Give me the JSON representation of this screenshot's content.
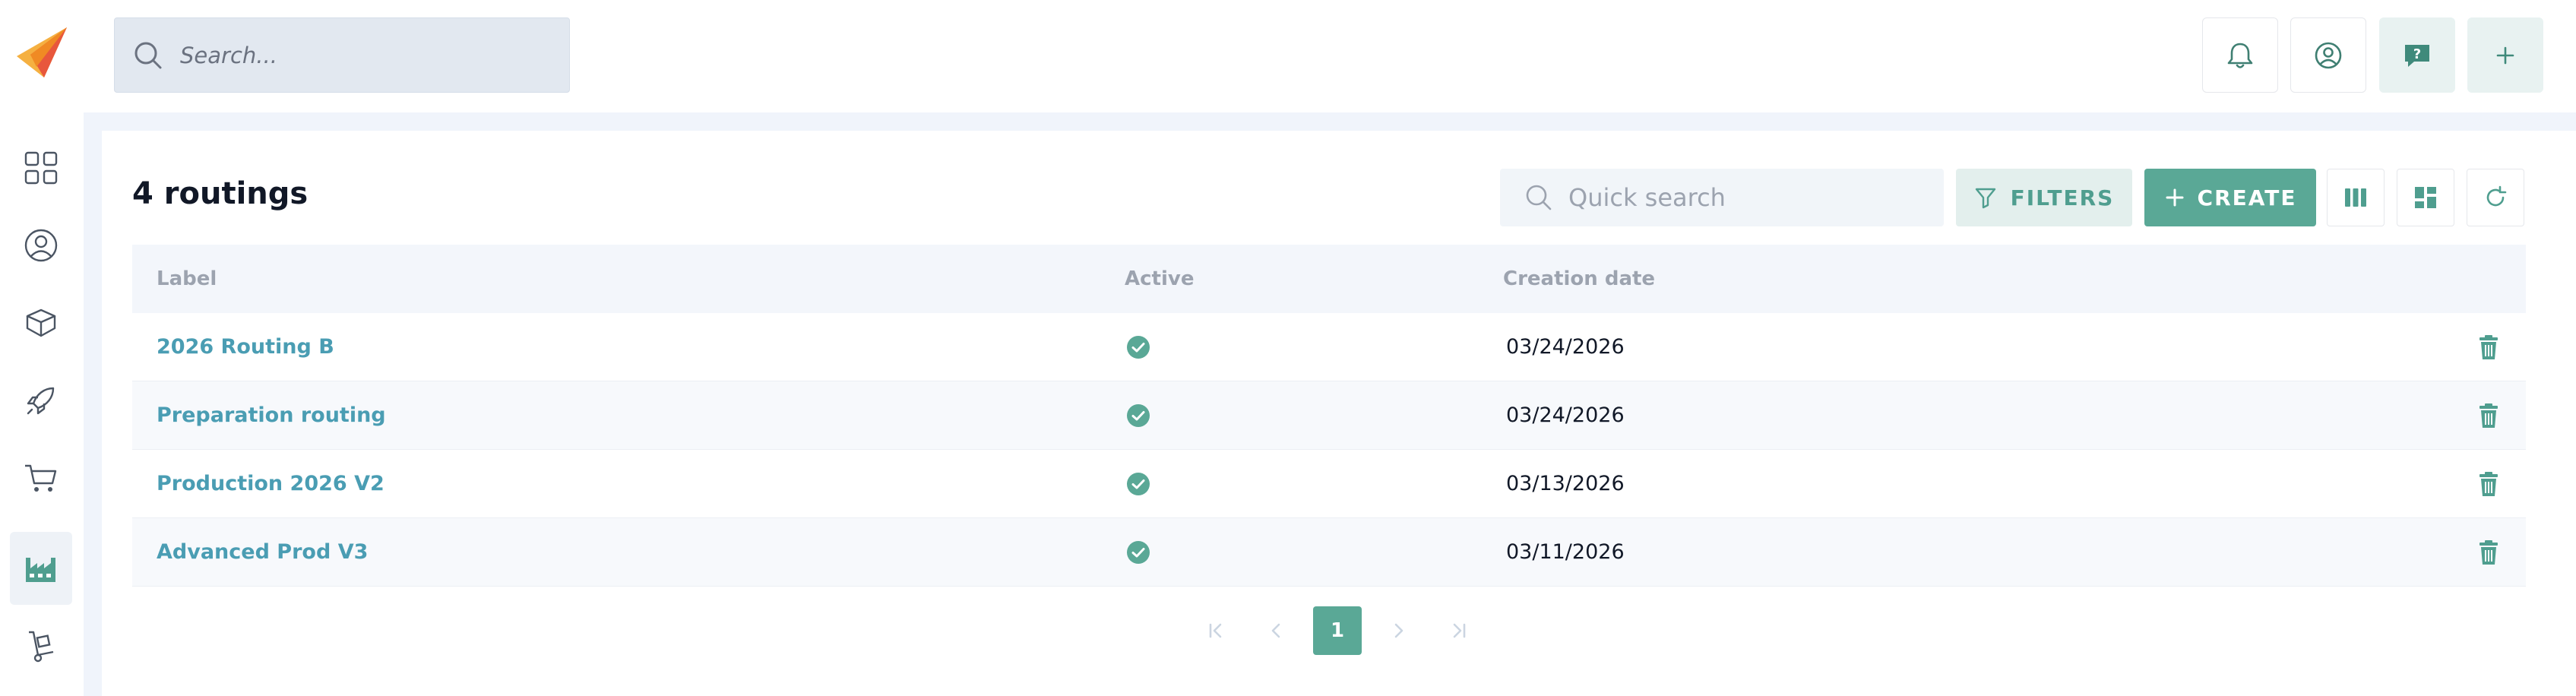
{
  "header": {
    "search_placeholder": "Search..."
  },
  "page": {
    "title": "4 routings",
    "quick_search_placeholder": "Quick search",
    "filters_label": "FILTERS",
    "create_label": "CREATE"
  },
  "table": {
    "columns": [
      "Label",
      "Active",
      "Creation date"
    ],
    "rows": [
      {
        "label": "2026 Routing B",
        "active": true,
        "date": "03/24/2026"
      },
      {
        "label": "Preparation routing",
        "active": true,
        "date": "03/24/2026"
      },
      {
        "label": "Production 2026 V2",
        "active": true,
        "date": "03/13/2026"
      },
      {
        "label": "Advanced Prod V3",
        "active": true,
        "date": "03/11/2026"
      }
    ]
  },
  "pagination": {
    "current_page": "1"
  },
  "colors": {
    "accent": "#5aa896",
    "link": "#4a9db3",
    "background": "#f0f4fb"
  },
  "icons": {
    "sidebar": [
      "dashboard-icon",
      "user-circle-icon",
      "box-icon",
      "rocket-icon",
      "cart-icon",
      "factory-icon",
      "hand-truck-icon"
    ],
    "topbar": [
      "bell-icon",
      "profile-icon",
      "help-chat-icon",
      "plus-icon"
    ]
  }
}
